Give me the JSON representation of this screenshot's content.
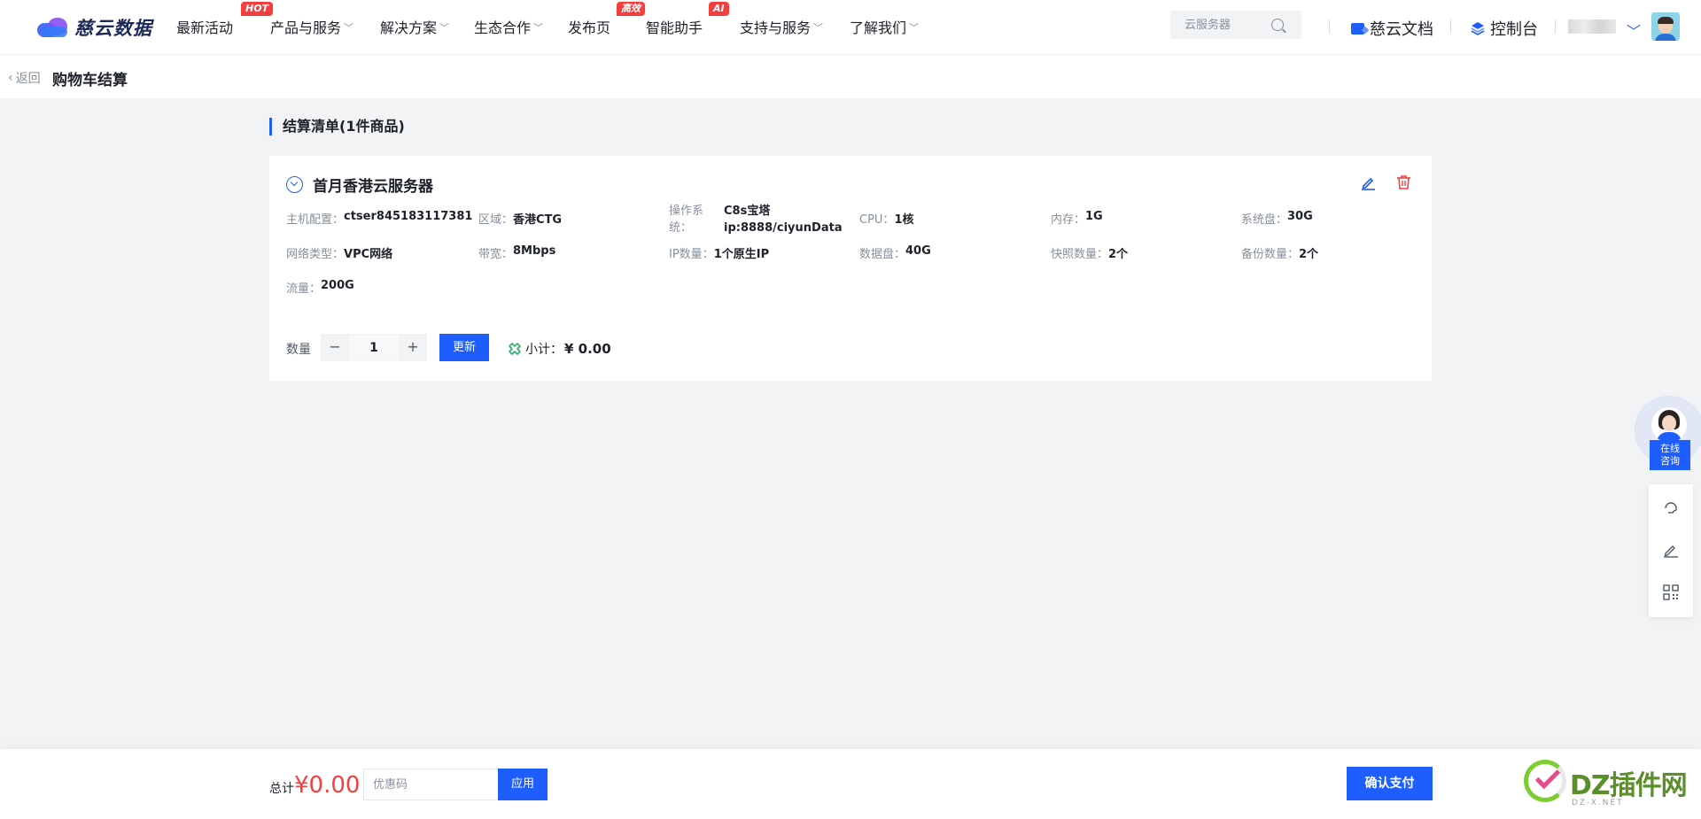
{
  "brand": {
    "name": "慈云数据"
  },
  "nav": {
    "items": [
      {
        "label": "最新活动",
        "badge": "HOT",
        "dropdown": false
      },
      {
        "label": "产品与服务",
        "badge": "",
        "dropdown": true
      },
      {
        "label": "解决方案",
        "badge": "",
        "dropdown": true
      },
      {
        "label": "生态合作",
        "badge": "",
        "dropdown": true
      },
      {
        "label": "发布页",
        "badge": "高效",
        "dropdown": false
      },
      {
        "label": "智能助手",
        "badge": "AI",
        "dropdown": false
      },
      {
        "label": "支持与服务",
        "badge": "",
        "dropdown": true
      },
      {
        "label": "了解我们",
        "badge": "",
        "dropdown": true
      }
    ],
    "search_placeholder": "云服务器",
    "docs_label": "慈云文档",
    "console_label": "控制台"
  },
  "subbar": {
    "back_label": "返回",
    "title": "购物车结算"
  },
  "cart": {
    "section_title": "结算清单(1件商品)",
    "item": {
      "name": "首月香港云服务器",
      "specs": [
        {
          "k": "主机配置：",
          "v": "ctser845183117381"
        },
        {
          "k": "区域：",
          "v": "香港CTG"
        },
        {
          "k": "操作系统：",
          "v": "C8s宝塔ip:8888/ciyunData"
        },
        {
          "k": "CPU：",
          "v": "1核"
        },
        {
          "k": "内存：",
          "v": "1G"
        },
        {
          "k": "系统盘：",
          "v": "30G"
        },
        {
          "k": "网络类型：",
          "v": "VPC网络"
        },
        {
          "k": "带宽：",
          "v": "8Mbps"
        },
        {
          "k": "IP数量：",
          "v": "1个原生IP"
        },
        {
          "k": "数据盘：",
          "v": "40G"
        },
        {
          "k": "快照数量：",
          "v": "2个"
        },
        {
          "k": "备份数量：",
          "v": "2个"
        },
        {
          "k": "流量：",
          "v": "200G"
        }
      ],
      "os_label_line1": "操作系",
      "os_label_line2": "统：",
      "os_value_line1": "C8s宝塔",
      "os_value_line2": "ip:8888/ciyunData",
      "quantity_label": "数量",
      "quantity": "1",
      "minus": "−",
      "plus": "+",
      "update_label": "更新",
      "subtotal_label": "小计：",
      "subtotal_value": "¥ 0.00"
    }
  },
  "float": {
    "consult_line1": "在线",
    "consult_line2": "咨询"
  },
  "footer": {
    "total_label": "总计",
    "total_value": "¥0.00",
    "coupon_placeholder": "优惠码",
    "apply_label": "应用",
    "confirm_label": "确认支付"
  },
  "watermark": {
    "text": "DZ插件网",
    "sub": "DZ-X.NET"
  },
  "colors": {
    "accent": "#1e5eff",
    "danger": "#f53f3f",
    "bg": "#f2f3f5"
  }
}
